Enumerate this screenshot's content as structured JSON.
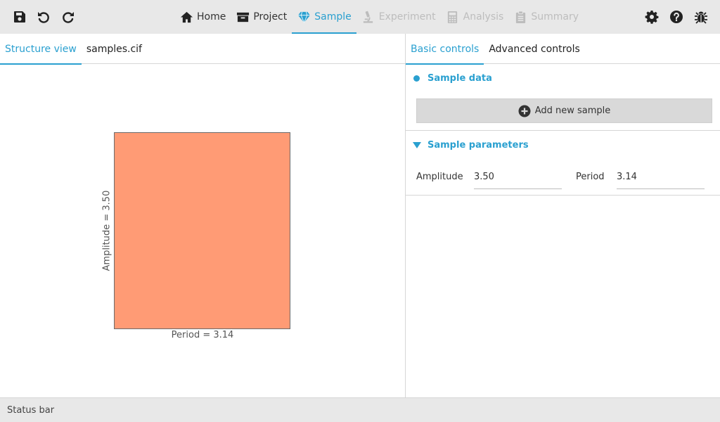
{
  "toolbar": {
    "left_icons": [
      "save-icon",
      "undo-icon",
      "redo-icon"
    ],
    "right_icons": [
      "gear-icon",
      "help-icon",
      "bug-icon"
    ]
  },
  "main_tabs": [
    {
      "label": "Home",
      "icon": "home-icon",
      "state": "normal"
    },
    {
      "label": "Project",
      "icon": "archive-box-icon",
      "state": "normal"
    },
    {
      "label": "Sample",
      "icon": "gem-icon",
      "state": "active"
    },
    {
      "label": "Experiment",
      "icon": "microscope-icon",
      "state": "disabled"
    },
    {
      "label": "Analysis",
      "icon": "calculator-icon",
      "state": "disabled"
    },
    {
      "label": "Summary",
      "icon": "clipboard-icon",
      "state": "disabled"
    }
  ],
  "left_panel": {
    "tabs": [
      {
        "label": "Structure view",
        "active": true
      },
      {
        "label": "samples.cif",
        "active": false
      }
    ],
    "structure": {
      "fill_color": "#ff9b75",
      "ylabel": "Amplitude = 3.50",
      "xlabel": "Period = 3.14"
    }
  },
  "right_panel": {
    "tabs": [
      {
        "label": "Basic controls",
        "active": true
      },
      {
        "label": "Advanced controls",
        "active": false
      }
    ],
    "sample_data": {
      "title": "Sample data",
      "add_button": "Add new sample"
    },
    "sample_parameters": {
      "title": "Sample parameters",
      "amplitude_label": "Amplitude",
      "amplitude_value": "3.50",
      "period_label": "Period",
      "period_value": "3.14"
    }
  },
  "status_bar": "Status bar",
  "colors": {
    "accent": "#2aa0d0",
    "appbar_bg": "#e8e8e8",
    "disabled": "#bdbdbd"
  }
}
